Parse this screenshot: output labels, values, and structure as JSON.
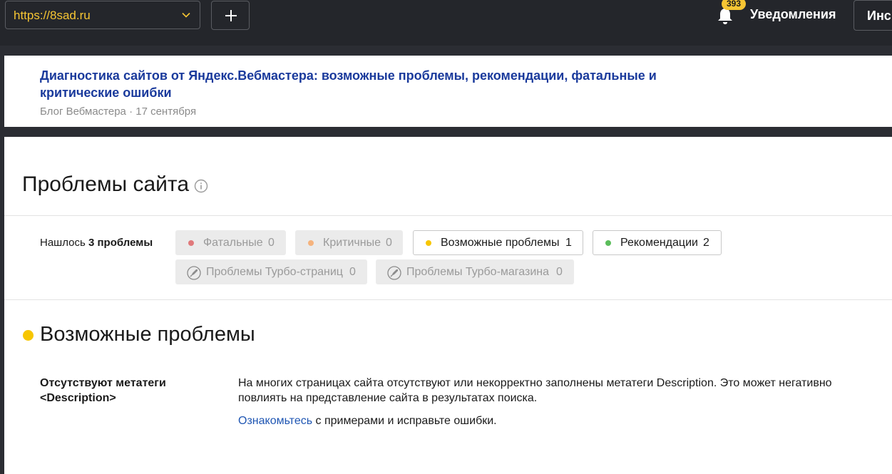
{
  "header": {
    "site": "https://8sad.ru",
    "add_label": "+",
    "notifications_count": "393",
    "notifications_label": "Уведомления",
    "tools_label": "Инс"
  },
  "news": {
    "title": "Диагностика сайтов от Яндекс.Вебмастера: возможные проблемы, рекомендации, фатальные и критические ошибки",
    "meta": "Блог Вебмастера · 17 сентября"
  },
  "problems": {
    "title": "Проблемы сайта",
    "found_prefix": "Нашлось",
    "found_count": "3 проблемы",
    "filters": [
      {
        "label": "Фатальные",
        "count": "0",
        "color": "#e0797b"
      },
      {
        "label": "Критичные",
        "count": "0",
        "color": "#f5b37d"
      },
      {
        "label": "Возможные проблемы",
        "count": "1",
        "color": "#f7c600"
      },
      {
        "label": "Рекомендации",
        "count": "2",
        "color": "#5bbd5b"
      },
      {
        "label": "Проблемы Турбо-страниц",
        "count": "0",
        "icon": "rocket-icon"
      },
      {
        "label": "Проблемы Турбо-магазина",
        "count": "0",
        "icon": "rocket-icon"
      }
    ]
  },
  "section": {
    "title": "Возможные проблемы",
    "color": "#f7c600",
    "item": {
      "name": "Отсутствуют метатеги <Description>",
      "description": "На многих страницах сайта отсутствуют или некорректно заполнены метатеги Description. Это может негативно повлиять на представление сайта в результатах поиска.",
      "link": "Ознакомьтесь",
      "action_rest": " с примерами и исправьте ошибки."
    }
  }
}
